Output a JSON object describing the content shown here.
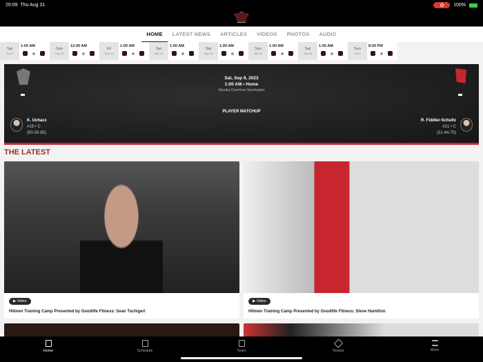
{
  "status": {
    "time": "20:09",
    "date": "Thu Aug 31",
    "battery": "100%"
  },
  "tabs": [
    "HOME",
    "LATEST NEWS",
    "ARTICLES",
    "VIDEOS",
    "PHOTOS",
    "AUDIO"
  ],
  "schedule": [
    {
      "day": "Sat",
      "date": "Sep 9",
      "time": "1:00 AM"
    },
    {
      "day": "Sun",
      "date": "Sep 10",
      "time": "12:00 AM"
    },
    {
      "day": "Fri",
      "date": "Sep 15",
      "time": "1:00 AM"
    },
    {
      "day": "Sat",
      "date": "Sep 16",
      "time": "1:00 AM"
    },
    {
      "day": "Sat",
      "date": "Sep 23",
      "time": "1:00 AM"
    },
    {
      "day": "Sun",
      "date": "Sep 24",
      "time": "1:00 AM"
    },
    {
      "day": "Sat",
      "date": "Sep 30",
      "time": "1:00 AM"
    },
    {
      "day": "Sun",
      "date": "Oct 1",
      "time": "8:00 PM"
    }
  ],
  "game": {
    "date": "Sat, Sep 9, 2023",
    "time": "1:00 AM • Home",
    "venue": "Siksika Deerfoot Sportsplex",
    "matchup_label": "PLAYER MATCHUP",
    "home_player": {
      "name": "K. Uchacz",
      "number": "#19 • C",
      "stats": "(50-35-85)"
    },
    "away_player": {
      "name": "R. Fiddler-Schultz",
      "number": "#21 • C",
      "stats": "(31-44-75)"
    }
  },
  "latest": {
    "title": "THE LATEST",
    "items": [
      {
        "badge": "Video",
        "title": "Hitmen Training Camp Presented by Goodlife Fitness: Sean Tschigerl"
      },
      {
        "badge": "Video",
        "title": "Hitmen Training Camp Presented by Goodlife Fitness: Steve Hamilton"
      }
    ]
  },
  "bottom_nav": [
    "Home",
    "Schedule",
    "Team",
    "Tickets",
    "More"
  ]
}
